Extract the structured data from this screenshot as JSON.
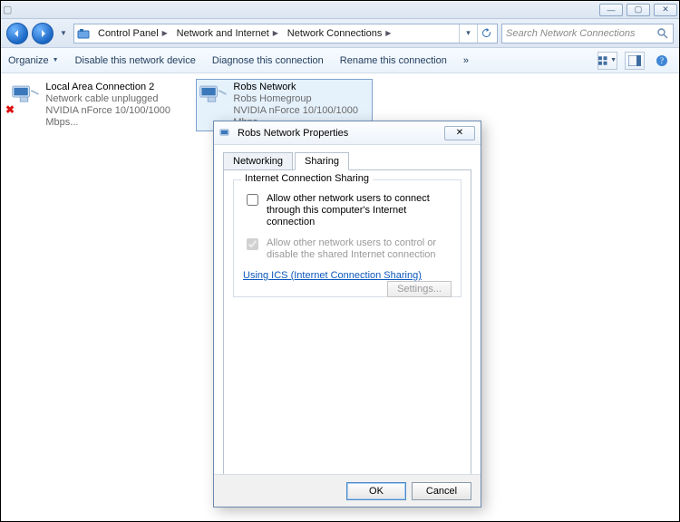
{
  "titlebar": {
    "caption": "",
    "active": false
  },
  "nav": {
    "crumbs": [
      "Control Panel",
      "Network and Internet",
      "Network Connections"
    ],
    "search_placeholder": "Search Network Connections"
  },
  "cmdbar": {
    "organize": "Organize",
    "disable": "Disable this network device",
    "diagnose": "Diagnose this connection",
    "rename": "Rename this connection",
    "more": "»"
  },
  "connections": [
    {
      "name": "Local Area Connection 2",
      "status": "Network cable unplugged",
      "device": "NVIDIA nForce 10/100/1000 Mbps...",
      "error": true,
      "selected": false
    },
    {
      "name": "Robs Network",
      "status": "Robs Homegroup",
      "device": "NVIDIA nForce 10/100/1000 Mbps...",
      "error": false,
      "selected": true
    }
  ],
  "dialog": {
    "title": "Robs Network Properties",
    "tabs": {
      "networking": "Networking",
      "sharing": "Sharing"
    },
    "group_legend": "Internet Connection Sharing",
    "chk1": "Allow other network users to connect through this computer's Internet connection",
    "chk2": "Allow other network users to control or disable the shared Internet connection",
    "link": "Using ICS (Internet Connection Sharing)",
    "settings": "Settings...",
    "ok": "OK",
    "cancel": "Cancel"
  }
}
